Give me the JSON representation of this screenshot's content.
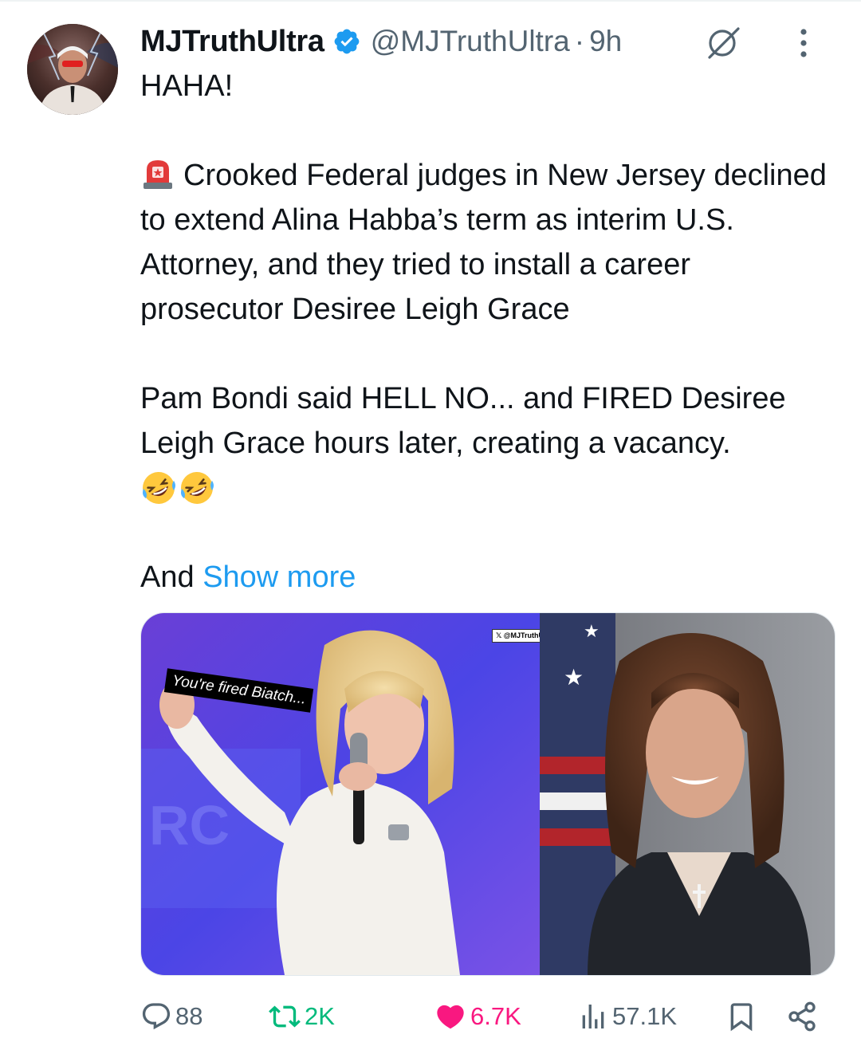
{
  "author": {
    "display_name": "MJTruthUltra",
    "handle": "@MJTruthUltra",
    "separator": "·",
    "time": "9h",
    "verified": true
  },
  "tweet": {
    "line1": "HAHA!",
    "para2": "Crooked Federal judges in New Jersey declined to extend Alina Habba’s term as interim U.S. Attorney, and they tried to install a career prosecutor Desiree Leigh Grace",
    "para3": "Pam Bondi said HELL NO... and FIRED Desiree Leigh Grace hours later, creating a vacancy.",
    "truncated_start": "And",
    "show_more": "Show more"
  },
  "media": {
    "caption": "You're fired Biatch...",
    "watermark": "𝕏 @MJTruthUltra"
  },
  "actions": {
    "replies": "88",
    "retweets": "2K",
    "likes": "6.7K",
    "views": "57.1K"
  },
  "icons": {
    "verified": "verified-badge-icon",
    "grok": "grok-icon",
    "more": "more-vertical-icon",
    "siren": "police-siren-emoji",
    "laugh": "rolling-on-floor-laughing-emoji",
    "reply": "reply-icon",
    "retweet": "retweet-icon",
    "like": "heart-icon",
    "views": "views-icon",
    "bookmark": "bookmark-icon",
    "share": "share-icon"
  },
  "colors": {
    "text": "#0f1419",
    "secondary": "#536471",
    "link": "#1d9bf0",
    "retweet": "#00ba7c",
    "like": "#f91880"
  }
}
